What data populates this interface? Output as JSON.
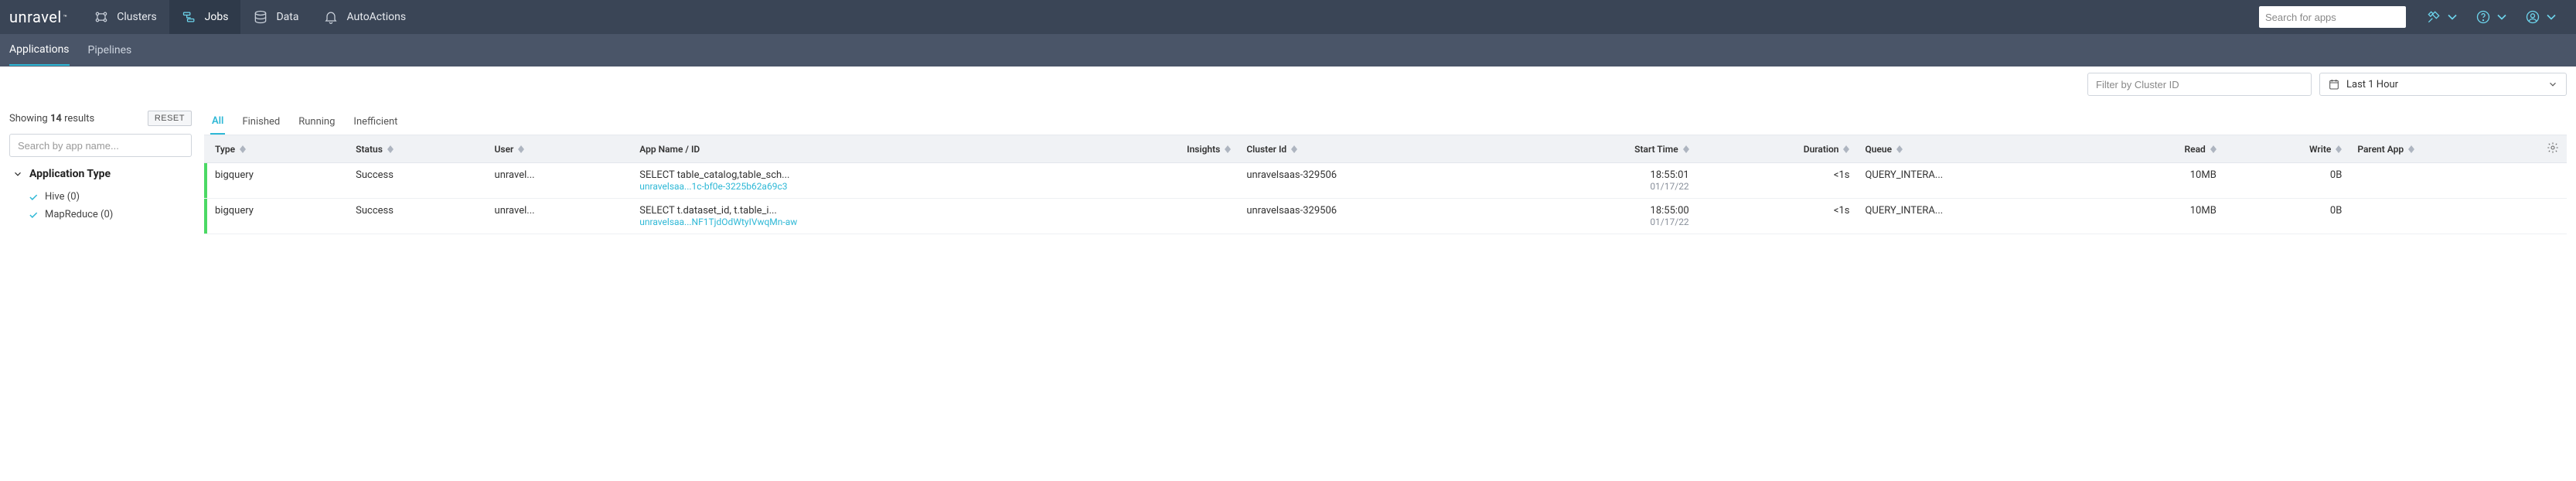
{
  "logo": "unravel",
  "topnav": [
    {
      "label": "Clusters",
      "icon": "clusters-icon"
    },
    {
      "label": "Jobs",
      "icon": "jobs-icon",
      "active": true
    },
    {
      "label": "Data",
      "icon": "data-icon"
    },
    {
      "label": "AutoActions",
      "icon": "bell-icon"
    }
  ],
  "search": {
    "placeholder": "Search for apps"
  },
  "subnav": [
    {
      "label": "Applications",
      "active": true
    },
    {
      "label": "Pipelines"
    }
  ],
  "filters": {
    "cluster_placeholder": "Filter by Cluster ID",
    "time_label": "Last 1 Hour"
  },
  "sidebar": {
    "showing_prefix": "Showing ",
    "showing_count": "14",
    "showing_suffix": " results",
    "reset": "RESET",
    "app_search_placeholder": "Search by app name...",
    "facet_title": "Application Type",
    "facets": [
      {
        "label": "Hive (0)",
        "checked": true
      },
      {
        "label": "MapReduce (0)",
        "checked": true
      }
    ]
  },
  "tabs": [
    {
      "label": "All",
      "active": true
    },
    {
      "label": "Finished"
    },
    {
      "label": "Running"
    },
    {
      "label": "Inefficient"
    }
  ],
  "columns": {
    "type": "Type",
    "status": "Status",
    "user": "User",
    "app": "App Name / ID",
    "insights": "Insights",
    "cluster": "Cluster Id",
    "start": "Start Time",
    "duration": "Duration",
    "queue": "Queue",
    "read": "Read",
    "write": "Write",
    "parent": "Parent App"
  },
  "rows": [
    {
      "type": "bigquery",
      "status": "Success",
      "user": "unravel...",
      "app_name": "SELECT table_catalog,table_sch...",
      "app_id": "unravelsaa...1c-bf0e-3225b62a69c3",
      "cluster": "unravelsaas-329506",
      "start_time": "18:55:01",
      "start_date": "01/17/22",
      "duration": "<1s",
      "queue": "QUERY_INTERA...",
      "read": "10MB",
      "write": "0B"
    },
    {
      "type": "bigquery",
      "status": "Success",
      "user": "unravel...",
      "app_name": "SELECT t.dataset_id, t.table_i...",
      "app_id": "unravelsaa...NF1TjdOdWtyIVwqMn-aw",
      "cluster": "unravelsaas-329506",
      "start_time": "18:55:00",
      "start_date": "01/17/22",
      "duration": "<1s",
      "queue": "QUERY_INTERA...",
      "read": "10MB",
      "write": "0B"
    }
  ],
  "colors": {
    "accent": "#2eb8d6",
    "success": "#4bd964",
    "navbg": "#3a4556"
  }
}
